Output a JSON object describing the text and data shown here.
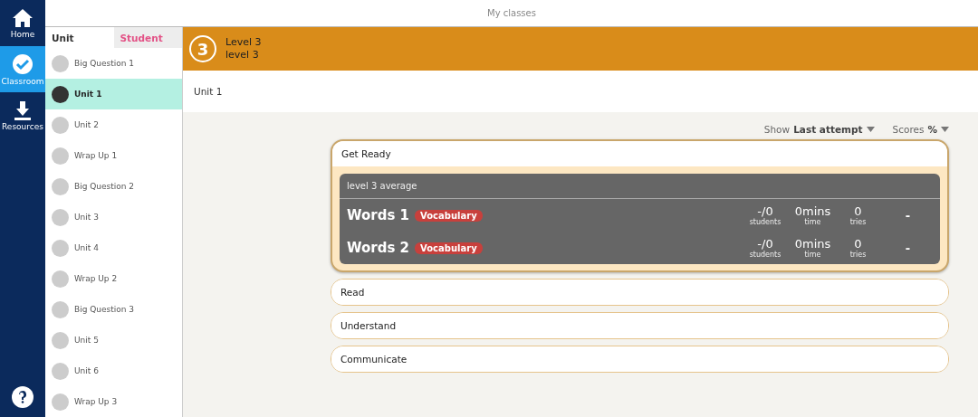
{
  "nav": [
    {
      "kind": "home",
      "label": "Home",
      "selected": false
    },
    {
      "kind": "classroom",
      "label": "Classroom",
      "selected": true
    },
    {
      "kind": "resources",
      "label": "Resources",
      "selected": false
    }
  ],
  "top_bar": {
    "title": "My classes"
  },
  "sidebar": {
    "tabs": [
      {
        "label": "Unit",
        "selected": true
      },
      {
        "label": "Student",
        "selected": false
      }
    ],
    "items": [
      {
        "label": "Big Question 1",
        "selected": false
      },
      {
        "label": "Unit 1",
        "selected": true
      },
      {
        "label": "Unit 2",
        "selected": false
      },
      {
        "label": "Wrap Up 1",
        "selected": false
      },
      {
        "label": "Big Question 2",
        "selected": false
      },
      {
        "label": "Unit 3",
        "selected": false
      },
      {
        "label": "Unit 4",
        "selected": false
      },
      {
        "label": "Wrap Up 2",
        "selected": false
      },
      {
        "label": "Big Question 3",
        "selected": false
      },
      {
        "label": "Unit 5",
        "selected": false
      },
      {
        "label": "Unit 6",
        "selected": false
      },
      {
        "label": "Wrap Up 3",
        "selected": false
      }
    ]
  },
  "level_header": {
    "badge": "3",
    "title": "Level 3",
    "subtitle": "level 3"
  },
  "unit_title": "Unit 1",
  "filters": [
    {
      "label": "Show",
      "value": "Last attempt"
    },
    {
      "label": "Scores",
      "value": "%"
    }
  ],
  "sections": [
    {
      "title": "Get Ready",
      "expanded": true,
      "average_label": "level 3 average",
      "activities": [
        {
          "name": "Words 1",
          "tag": "Vocabulary",
          "students": "-/0",
          "students_label": "students",
          "time": "0mins",
          "time_label": "time",
          "tries": "0",
          "tries_label": "tries",
          "score": "-"
        },
        {
          "name": "Words 2",
          "tag": "Vocabulary",
          "students": "-/0",
          "students_label": "students",
          "time": "0mins",
          "time_label": "time",
          "tries": "0",
          "tries_label": "tries",
          "score": "-"
        }
      ]
    },
    {
      "title": "Read",
      "expanded": false
    },
    {
      "title": "Understand",
      "expanded": false
    },
    {
      "title": "Communicate",
      "expanded": false
    }
  ]
}
